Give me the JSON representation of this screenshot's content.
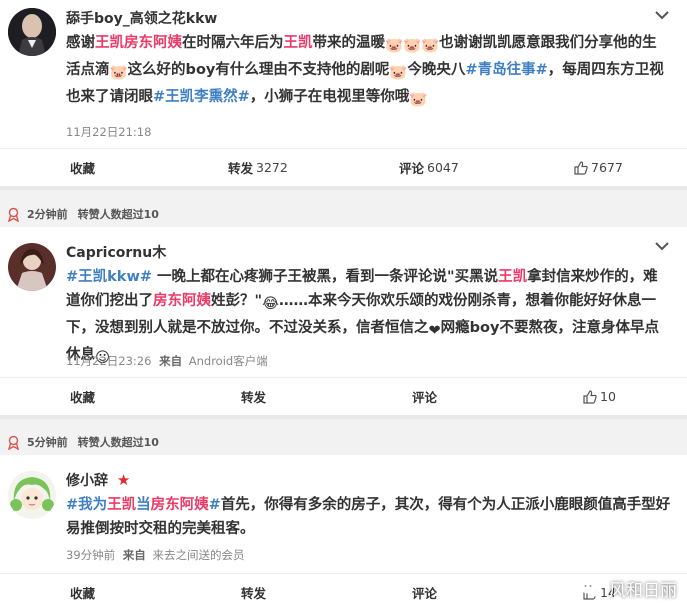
{
  "posts": [
    {
      "username": "舔手boy_高领之花kkw",
      "content": [
        {
          "t": "感谢",
          "c": "n"
        },
        {
          "t": "王凯",
          "c": "hl"
        },
        {
          "t": "房东阿姨",
          "c": "hl"
        },
        {
          "t": "在时隔六年后为",
          "c": "n"
        },
        {
          "t": "王凯",
          "c": "hl"
        },
        {
          "t": "带来的温暖",
          "c": "n"
        },
        {
          "t": "🐷🐷🐷",
          "c": "emo"
        },
        {
          "t": "也谢谢凯凯愿意跟我们分享他的生活点滴",
          "c": "n"
        },
        {
          "t": "🐷",
          "c": "emo"
        },
        {
          "t": "这么好的boy有什么理由不支持他的剧呢",
          "c": "n"
        },
        {
          "t": "🐷",
          "c": "emo"
        },
        {
          "t": "今晚央八",
          "c": "n"
        },
        {
          "t": "#青岛往事#",
          "c": "topic"
        },
        {
          "t": "，每周四东方卫视也来了请闭眼",
          "c": "n"
        },
        {
          "t": "#王凯李熏然#",
          "c": "topic"
        },
        {
          "t": "，小狮子在电视里等你哦",
          "c": "n"
        },
        {
          "t": "🐷",
          "c": "emo"
        }
      ],
      "time": "11月22日21:18",
      "source_prefix": "",
      "source": "",
      "actions": {
        "favorite": "收藏",
        "repost": "转发",
        "repost_count": "3272",
        "comment": "评论",
        "comment_count": "6047",
        "like_count": "7677"
      }
    },
    {
      "note": {
        "time": "2分钟前",
        "text": "转赞人数超过10"
      },
      "username": "Capricornu木",
      "content": [
        {
          "t": "#王凯",
          "c": "topic"
        },
        {
          "t": "kkw#",
          "c": "topic"
        },
        {
          "t": " 一晚上都在心疼狮子王被黑，看到一条评论说\"买黑说",
          "c": "n"
        },
        {
          "t": "王凯",
          "c": "hl"
        },
        {
          "t": "拿封信来炒作的，难道你们挖出了",
          "c": "n"
        },
        {
          "t": "房东阿姨",
          "c": "hl"
        },
        {
          "t": "姓彭？\"",
          "c": "n"
        },
        {
          "t": "😂",
          "c": "emo"
        },
        {
          "t": "……本来今天你欢乐颂的戏份刚杀青，想着你能好好休息一下，没想到别人就是不放过你。不过没关系，信者恒信之",
          "c": "n"
        },
        {
          "t": "❤",
          "c": "emo"
        },
        {
          "t": "网瘾boy不要熬夜，注意身体早点休息",
          "c": "n"
        },
        {
          "t": "☺",
          "c": "emo"
        }
      ],
      "time": "11月22日23:26",
      "source_prefix": "来自",
      "source": "Android客户端",
      "actions": {
        "favorite": "收藏",
        "repost": "转发",
        "repost_count": "",
        "comment": "评论",
        "comment_count": "",
        "like_count": "10"
      }
    },
    {
      "note": {
        "time": "5分钟前",
        "text": "转赞人数超过10"
      },
      "username": "修小辞",
      "content": [
        {
          "t": "#我为",
          "c": "topic"
        },
        {
          "t": "王凯",
          "c": "hl"
        },
        {
          "t": "当",
          "c": "topic"
        },
        {
          "t": "房东阿姨",
          "c": "hl"
        },
        {
          "t": "#",
          "c": "topic"
        },
        {
          "t": "首先，你得有多余的房子，其次，得有个为人正派小鹿眼颜值高手型好易推倒按时交租的完美租客。",
          "c": "n"
        }
      ],
      "time": "39分钟前",
      "source_prefix": "来自",
      "source": "来去之间送的会员",
      "actions": {
        "favorite": "收藏",
        "repost": "转发",
        "repost_count": "",
        "comment": "评论",
        "comment_count": "",
        "like_count": "14"
      }
    }
  ],
  "watermark": "风和日丽",
  "colors": {
    "highlight": "#eb3a68",
    "topic": "#3f7fc4",
    "star": "#e8262b"
  }
}
